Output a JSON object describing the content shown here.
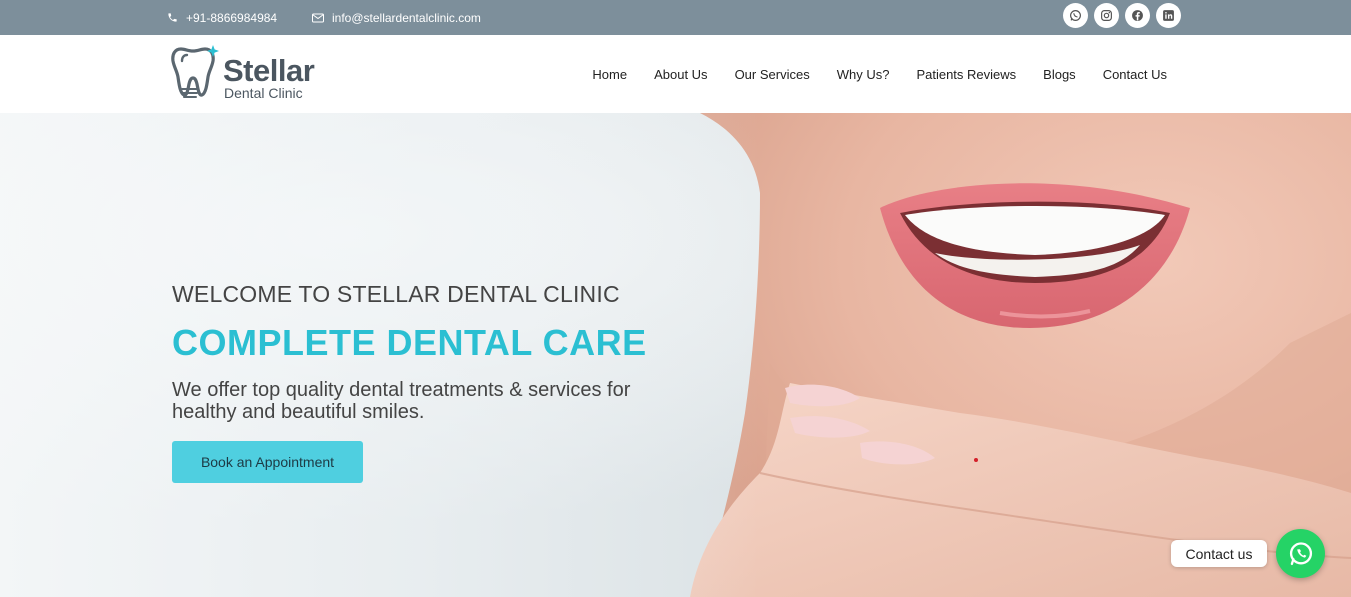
{
  "topbar": {
    "phone": "+91-8866984984",
    "email": "info@stellardentalclinic.com",
    "socials": [
      "whatsapp-icon",
      "instagram-icon",
      "facebook-icon",
      "linkedin-icon"
    ]
  },
  "logo": {
    "name": "Stellar",
    "subtitle": "Dental Clinic"
  },
  "nav": {
    "items": [
      "Home",
      "About Us",
      "Our Services",
      "Why Us?",
      "Patients Reviews",
      "Blogs",
      "Contact Us"
    ]
  },
  "hero": {
    "welcome": "WELCOME TO STELLAR DENTAL CLINIC",
    "title": "COMPLETE DENTAL CARE",
    "description": "We offer top quality dental treatments & services for healthy and beautiful smiles.",
    "button_label": "Book an Appointment"
  },
  "floating": {
    "contact_label": "Contact us"
  },
  "colors": {
    "topbar": "#7d8f9b",
    "accent": "#2bbfd2",
    "button": "#4fcfe0",
    "whatsapp": "#25d366"
  }
}
